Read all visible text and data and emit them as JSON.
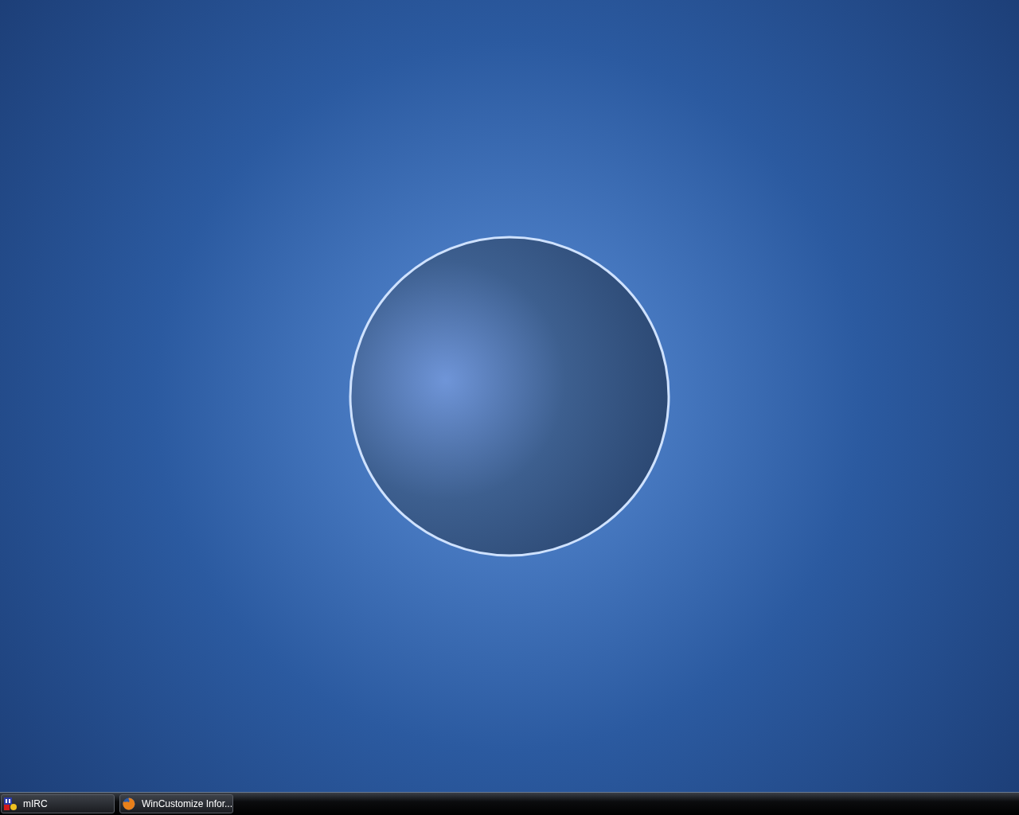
{
  "taskbar": {
    "buttons": [
      {
        "label": "mIRC",
        "kind": "chat"
      },
      {
        "label": "WinCustomize Infor...",
        "kind": "browser"
      }
    ]
  }
}
